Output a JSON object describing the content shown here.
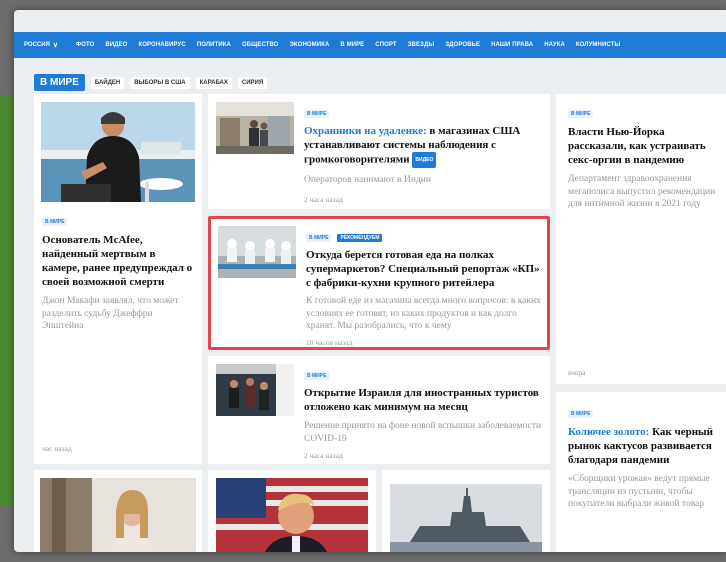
{
  "nav": {
    "region": "РОССИЯ",
    "items": [
      "ФОТО",
      "ВИДЕО",
      "КОРОНАВИРУС",
      "ПОЛИТИКА",
      "ОБЩЕСТВО",
      "ЭКОНОМИКА",
      "В МИРЕ",
      "СПОРТ",
      "ЗВЕЗДЫ",
      "ЗДОРОВЬЕ",
      "НАШИ ПРАВА",
      "НАУКА",
      "КОЛУМНИСТЫ"
    ]
  },
  "section": {
    "title": "В МИРЕ",
    "tags": [
      "БАЙДЕН",
      "ВЫБОРЫ В США",
      "КАРАБАХ",
      "СИРИЯ"
    ]
  },
  "kicker_label": "В МИРЕ",
  "reco_label": "РЕКОМЕНДУЕМ",
  "video_label": "ВИДЕО",
  "articles": {
    "mcafee": {
      "title": "Основатель McAfee, найденный мертвым в камере, ранее предупреждал о своей возможной смерти",
      "lead": "Джон Макафи заявлял, что может разделить судьбу Джеффри Эпштейна",
      "time": "час назад"
    },
    "guards": {
      "title_highlight": "Охранники на удаленке:",
      "title_rest": "в магазинах США устанавливают системы наблюдения с громкоговорителями",
      "lead": "Операторов нанимают в Индии",
      "time": "2 часа назад"
    },
    "food": {
      "title": "Откуда берется готовая еда на полках супермаркетов? Специальный репортаж «КП» с фабрики-кухни крупного ритейлера",
      "lead": "К готовой еде из магазина всегда много вопросов: в каких условиях ее готовят, из каких продуктов и как долго хранят. Мы разобрались, что к чему",
      "time": "10 часов назад"
    },
    "israel": {
      "title": "Открытие Израиля для иностранных туристов отложено как минимум на месяц",
      "lead": "Решение принято на фоне новой вспышки заболеваемости COVID-19",
      "time": "2 часа назад"
    },
    "newyork": {
      "title": "Власти Нью-Йорка рассказали, как устраивать секс-оргии в пандемию",
      "lead": "Департамент здравоохранения мегаполиса выпустил рекомендации для интимной жизни в 2021 году",
      "time": "вчера"
    },
    "cactus": {
      "title_highlight": "Колючее золото:",
      "title_rest": "Как черный рынок кактусов развивается благодаря пандемии",
      "lead": "«Сборщики урожая» ведут прямые трансляции из пустыни, чтобы покупатели выбрали живой товар"
    }
  }
}
